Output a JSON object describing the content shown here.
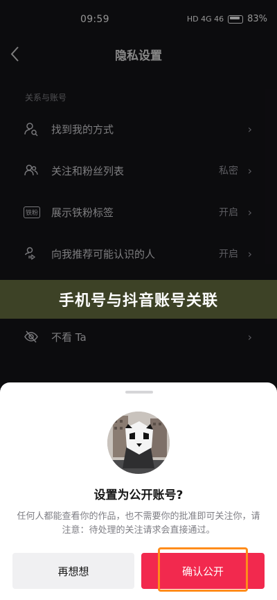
{
  "status_bar": {
    "time": "09:59",
    "network": "HD 4G 46",
    "battery": "83%"
  },
  "nav": {
    "title": "隐私设置"
  },
  "section": {
    "label": "关系与账号"
  },
  "settings": [
    {
      "label": "找到我的方式",
      "value": "",
      "icon": "person-search-icon"
    },
    {
      "label": "关注和粉丝列表",
      "value": "私密",
      "icon": "people-icon"
    },
    {
      "label": "展示铁粉标签",
      "value": "开启",
      "icon": "fan-badge-icon"
    },
    {
      "label": "向我推荐可能认识的人",
      "value": "开启",
      "icon": "person-share-icon"
    },
    {
      "label": "",
      "value": "",
      "icon": "list-icon"
    },
    {
      "label": "不看 Ta",
      "value": "",
      "icon": "eye-off-icon"
    }
  ],
  "fan_badge_text": "铁粉",
  "caption": "手机号与抖音账号关联",
  "sheet": {
    "title": "设置为公开账号?",
    "description": "任何人都能查看你的作品，也不需要你的批准即可关注你，请注意：待处理的关注请求会直接通过。",
    "cancel_label": "再想想",
    "confirm_label": "确认公开"
  },
  "colors": {
    "accent": "#f2294e",
    "highlight": "#ff8c1a",
    "caption_bg": "#3d4226"
  }
}
